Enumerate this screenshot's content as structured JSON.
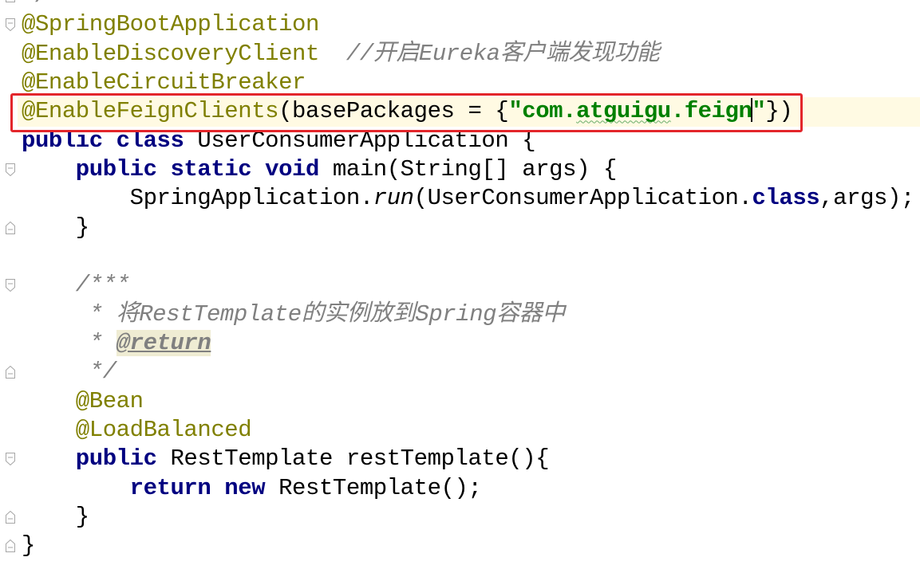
{
  "theme": {
    "background": "#FFFFFF",
    "current_line": "#FFFAE3",
    "text": "#000000",
    "annotation": "#808000",
    "keyword": "#000080",
    "string": "#008000",
    "comment": "#808080",
    "doc_tag_background": "#EFECD3",
    "typo_underline": "#6AAE6A",
    "callout": "#E3262B",
    "fold_marker": "#A6A6A6",
    "caret": "#000000"
  },
  "editor": {
    "lines": [
      {
        "fold": "fold-end-icon",
        "tokens": [
          {
            "doc": "*/"
          }
        ]
      },
      {
        "fold": "fold-start-icon",
        "tokens": [
          {
            "annotation": "@SpringBootApplication"
          }
        ]
      },
      {
        "tokens": [
          {
            "annotation": "@EnableDiscoveryClient"
          },
          {
            "comment": "  //开启Eureka客户端发现功能"
          }
        ]
      },
      {
        "tokens": [
          {
            "annotation": "@EnableCircuitBreaker"
          }
        ]
      },
      {
        "current": true,
        "tokens": [
          {
            "annotation": "@EnableFeignClients"
          },
          {
            "plain": "(basePackages = {"
          },
          {
            "string": "\"com."
          },
          {
            "string": "atguigu",
            "typo": true
          },
          {
            "string": ".feign"
          },
          {
            "caret": true
          },
          {
            "string": "\""
          },
          {
            "plain": "})"
          }
        ]
      },
      {
        "tokens": [
          {
            "keyword": "public class"
          },
          {
            "plain": " UserConsumerApplication {"
          }
        ]
      },
      {
        "fold": "fold-start-icon",
        "tokens": [
          {
            "keyword": "    public static void"
          },
          {
            "plain": " main(String[] args) {"
          }
        ]
      },
      {
        "tokens": [
          {
            "plain": "        SpringApplication."
          },
          {
            "static": "run"
          },
          {
            "plain": "(UserConsumerApplication."
          },
          {
            "keyword": "class"
          },
          {
            "plain": ",args);"
          }
        ]
      },
      {
        "fold": "fold-end-icon",
        "tokens": [
          {
            "plain": "    }"
          }
        ]
      },
      {
        "tokens": []
      },
      {
        "fold": "fold-start-icon",
        "tokens": [
          {
            "doc": "    /***"
          }
        ]
      },
      {
        "tokens": [
          {
            "doc": "     * 将RestTemplate的实例放到Spring容器中"
          }
        ]
      },
      {
        "tokens": [
          {
            "doc": "     * "
          },
          {
            "doctag": "@return"
          }
        ]
      },
      {
        "fold": "fold-end-icon",
        "tokens": [
          {
            "doc": "     */"
          }
        ]
      },
      {
        "tokens": [
          {
            "annotation": "    @Bean"
          }
        ]
      },
      {
        "tokens": [
          {
            "annotation": "    @LoadBalanced"
          }
        ]
      },
      {
        "fold": "fold-start-icon",
        "tokens": [
          {
            "keyword": "    public"
          },
          {
            "plain": " RestTemplate restTemplate(){"
          }
        ]
      },
      {
        "tokens": [
          {
            "keyword": "        return new"
          },
          {
            "plain": " RestTemplate();"
          }
        ]
      },
      {
        "fold": "fold-end-icon",
        "tokens": [
          {
            "plain": "    }"
          }
        ]
      },
      {
        "fold": "fold-end-icon",
        "tokens": [
          {
            "plain": "}"
          }
        ]
      }
    ]
  }
}
